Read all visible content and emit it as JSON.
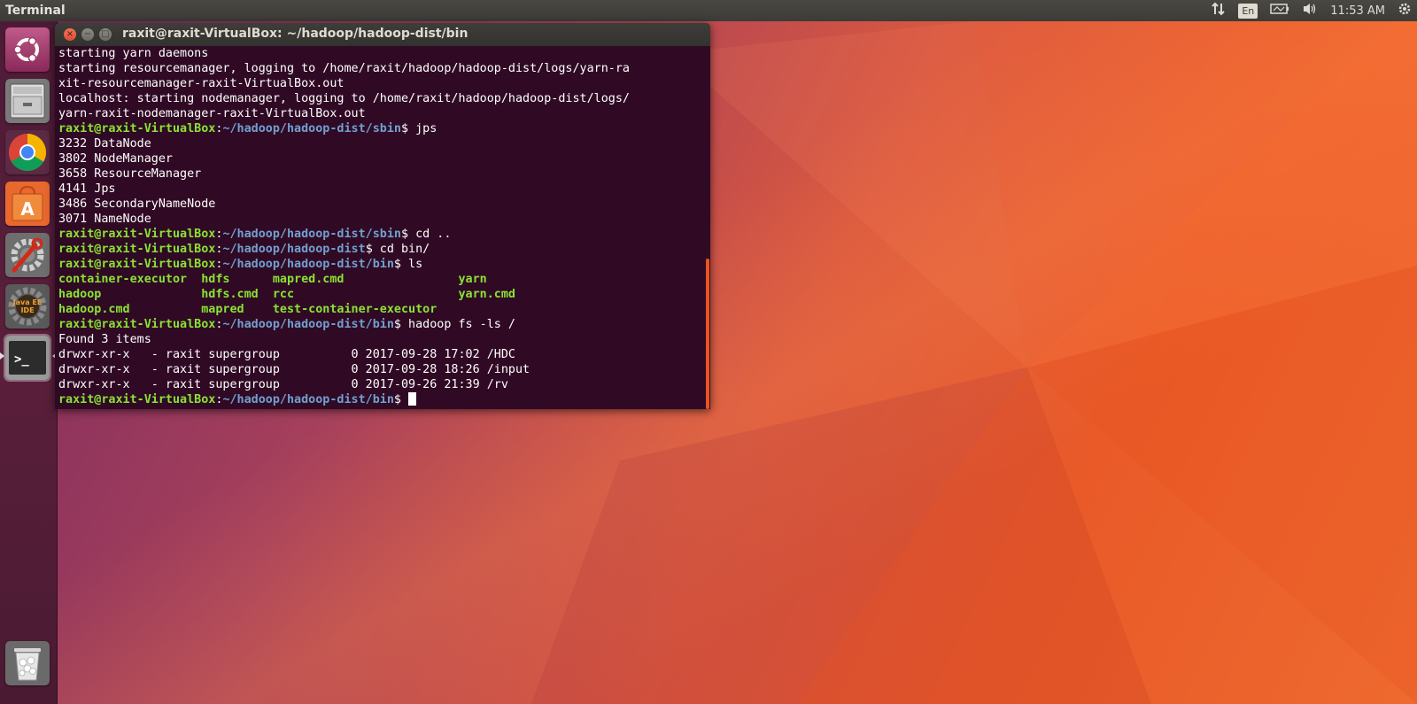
{
  "top_panel": {
    "title": "Terminal",
    "keyboard_layout": "En",
    "clock": "11:53 AM",
    "icons": [
      "network-transfer-icon",
      "keyboard-layout-icon",
      "battery-icon",
      "volume-icon",
      "settings-gear-icon"
    ]
  },
  "launcher": {
    "items": [
      {
        "name": "ubuntu-dash",
        "icon": "ubuntu-logo-icon"
      },
      {
        "name": "files",
        "icon": "file-cabinet-icon"
      },
      {
        "name": "chrome",
        "icon": "chrome-icon"
      },
      {
        "name": "software-center",
        "icon": "shopping-bag-icon",
        "glyph": "A"
      },
      {
        "name": "system-settings",
        "icon": "wrench-gear-icon"
      },
      {
        "name": "eclipse-javaee",
        "icon": "java-ee-gear-icon",
        "label_top": "Java EE",
        "label_bottom": "IDE"
      },
      {
        "name": "terminal",
        "icon": "terminal-icon",
        "glyph": ">_",
        "active": true
      },
      {
        "name": "trash",
        "icon": "trash-icon"
      }
    ]
  },
  "terminal": {
    "title": "raxit@raxit-VirtualBox: ~/hadoop/hadoop-dist/bin",
    "window_buttons": {
      "close": "×",
      "minimize": "−",
      "maximize": "□"
    },
    "prompt_user": "raxit@raxit-VirtualBox",
    "prompt_sep": ":",
    "lines": [
      {
        "type": "text",
        "text": "starting yarn daemons"
      },
      {
        "type": "text",
        "text": "starting resourcemanager, logging to /home/raxit/hadoop/hadoop-dist/logs/yarn-ra"
      },
      {
        "type": "text",
        "text": "xit-resourcemanager-raxit-VirtualBox.out"
      },
      {
        "type": "text",
        "text": "localhost: starting nodemanager, logging to /home/raxit/hadoop/hadoop-dist/logs/"
      },
      {
        "type": "text",
        "text": "yarn-raxit-nodemanager-raxit-VirtualBox.out"
      },
      {
        "type": "prompt",
        "path": "~/hadoop/hadoop-dist/sbin",
        "cmd": "$ jps"
      },
      {
        "type": "text",
        "text": "3232 DataNode"
      },
      {
        "type": "text",
        "text": "3802 NodeManager"
      },
      {
        "type": "text",
        "text": "3658 ResourceManager"
      },
      {
        "type": "text",
        "text": "4141 Jps"
      },
      {
        "type": "text",
        "text": "3486 SecondaryNameNode"
      },
      {
        "type": "text",
        "text": "3071 NameNode"
      },
      {
        "type": "prompt",
        "path": "~/hadoop/hadoop-dist/sbin",
        "cmd": "$ cd .."
      },
      {
        "type": "prompt",
        "path": "~/hadoop/hadoop-dist",
        "cmd": "$ cd bin/"
      },
      {
        "type": "prompt",
        "path": "~/hadoop/hadoop-dist/bin",
        "cmd": "$ ls"
      },
      {
        "type": "ls",
        "text": "container-executor  hdfs      mapred.cmd                yarn"
      },
      {
        "type": "ls",
        "text": "hadoop              hdfs.cmd  rcc                       yarn.cmd"
      },
      {
        "type": "ls",
        "text": "hadoop.cmd          mapred    test-container-executor"
      },
      {
        "type": "prompt",
        "path": "~/hadoop/hadoop-dist/bin",
        "cmd": "$ hadoop fs -ls /"
      },
      {
        "type": "text",
        "text": "Found 3 items"
      },
      {
        "type": "text",
        "text": "drwxr-xr-x   - raxit supergroup          0 2017-09-28 17:02 /HDC"
      },
      {
        "type": "text",
        "text": "drwxr-xr-x   - raxit supergroup          0 2017-09-28 18:26 /input"
      },
      {
        "type": "text",
        "text": "drwxr-xr-x   - raxit supergroup          0 2017-09-26 21:39 /rv"
      },
      {
        "type": "prompt",
        "path": "~/hadoop/hadoop-dist/bin",
        "cmd": "$ ",
        "cursor": true
      }
    ]
  },
  "colors": {
    "terminal_bg": "#300a24",
    "prompt_user": "#8ae234",
    "prompt_path": "#729fcf",
    "accent_orange": "#e95420"
  }
}
